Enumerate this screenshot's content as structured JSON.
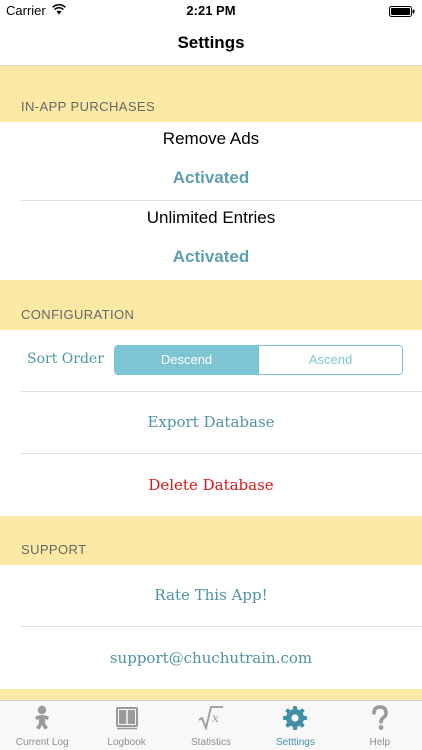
{
  "status_bar": {
    "carrier": "Carrier",
    "time": "2:21 PM"
  },
  "nav": {
    "title": "Settings"
  },
  "in_app": {
    "header": "IN-APP PURCHASES",
    "remove_ads": "Remove Ads",
    "remove_ads_status": "Activated",
    "unlimited": "Unlimited Entries",
    "unlimited_status": "Activated"
  },
  "configuration": {
    "header": "CONFIGURATION",
    "sort_label": "Sort Order",
    "sort_options": [
      "Descend",
      "Ascend"
    ],
    "sort_selected": "Descend",
    "export": "Export Database",
    "delete": "Delete Database"
  },
  "support": {
    "header": "SUPPORT",
    "rate": "Rate This App!",
    "email": "support@chuchutrain.com"
  },
  "tabs": [
    {
      "label": "Current Log",
      "icon": "baby-icon"
    },
    {
      "label": "Logbook",
      "icon": "book-icon"
    },
    {
      "label": "Statistics",
      "icon": "sqrt-icon"
    },
    {
      "label": "Setttings",
      "icon": "gear-icon",
      "active": true
    },
    {
      "label": "Help",
      "icon": "question-icon"
    }
  ],
  "colors": {
    "accent": "#7ec5d4",
    "section_bg": "#fce9a6",
    "danger": "#d81616",
    "active_tab": "#3f8fa8"
  }
}
